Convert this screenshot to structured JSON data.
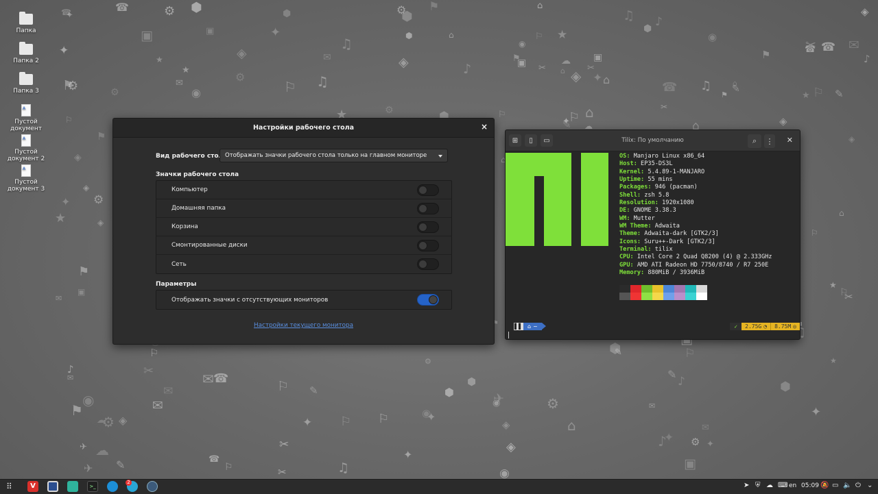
{
  "desktop": {
    "icons": [
      {
        "label": "Папка",
        "kind": "folder"
      },
      {
        "label": "Папка 2",
        "kind": "folder"
      },
      {
        "label": "Папка 3",
        "kind": "folder"
      },
      {
        "label": "Пустой документ",
        "kind": "document"
      },
      {
        "label": "Пустой документ 2",
        "kind": "document"
      },
      {
        "label": "Пустой документ 3",
        "kind": "document"
      }
    ]
  },
  "settings_window": {
    "title": "Настройки рабочего стола",
    "close_glyph": "×",
    "desktop_view_label": "Вид рабочего стола",
    "desktop_view_value": "Отображать значки рабочего стола только на главном мониторе",
    "icons_section_label": "Значки рабочего стола",
    "icon_rows": [
      {
        "label": "Компьютер",
        "on": false
      },
      {
        "label": "Домашняя папка",
        "on": false
      },
      {
        "label": "Корзина",
        "on": false
      },
      {
        "label": "Смонтированные диски",
        "on": false
      },
      {
        "label": "Сеть",
        "on": false
      }
    ],
    "params_section_label": "Параметры",
    "param_rows": [
      {
        "label": "Отображать значки с отсутствующих мониторов",
        "on": true
      }
    ],
    "monitor_link": "Настройки текущего монитора"
  },
  "terminal": {
    "title": "Tilix: По умолчанию",
    "accent_color": "#7fe03a",
    "info": [
      {
        "key": "OS",
        "value": "Manjaro Linux x86_64"
      },
      {
        "key": "Host",
        "value": "EP35-DS3L"
      },
      {
        "key": "Kernel",
        "value": "5.4.89-1-MANJARO"
      },
      {
        "key": "Uptime",
        "value": "55 mins"
      },
      {
        "key": "Packages",
        "value": "946 (pacman)"
      },
      {
        "key": "Shell",
        "value": "zsh 5.8"
      },
      {
        "key": "Resolution",
        "value": "1920x1080"
      },
      {
        "key": "DE",
        "value": "GNOME 3.38.3"
      },
      {
        "key": "WM",
        "value": "Mutter"
      },
      {
        "key": "WM Theme",
        "value": "Adwaita"
      },
      {
        "key": "Theme",
        "value": "Adwaita-dark [GTK2/3]"
      },
      {
        "key": "Icons",
        "value": "Suru++-Dark [GTK2/3]"
      },
      {
        "key": "Terminal",
        "value": "tilix"
      },
      {
        "key": "CPU",
        "value": "Intel Core 2 Quad Q8200 (4) @ 2.333GHz"
      },
      {
        "key": "GPU",
        "value": "AMD ATI Radeon HD 7750/8740 / R7 250E"
      },
      {
        "key": "Memory",
        "value": "880MiB / 3936MiB"
      }
    ],
    "palette_top": [
      "#2b2b2b",
      "#e0272b",
      "#6fbe2c",
      "#e8c12b",
      "#4d86d6",
      "#a276b0",
      "#21b8b8",
      "#d8d8d8"
    ],
    "palette_bottom": [
      "#555555",
      "#f03434",
      "#8fe045",
      "#f4d84a",
      "#6fa0ea",
      "#bb8fca",
      "#3ad3d3",
      "#ffffff"
    ],
    "prompt": {
      "home_glyph": "~",
      "status_check": "✓",
      "mem1": "2.75G",
      "mem2": "8.75M"
    }
  },
  "taskbar": {
    "keyboard_layout": "en",
    "clock": "05:09"
  }
}
